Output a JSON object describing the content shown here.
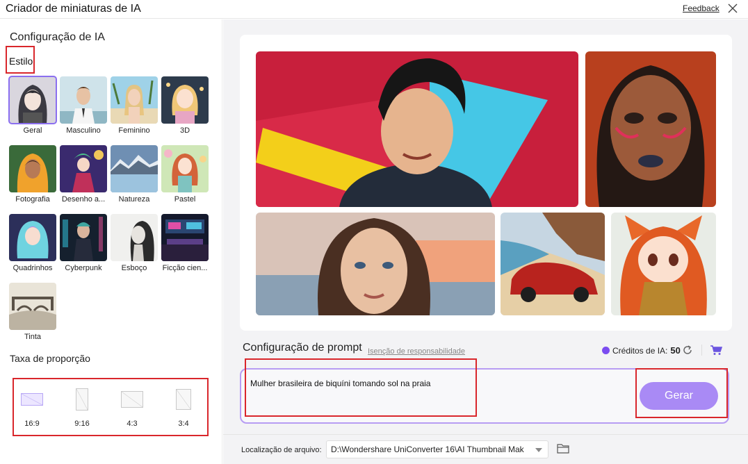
{
  "window": {
    "title": "Criador de miniaturas de IA",
    "feedback": "Feedback"
  },
  "left": {
    "section_title": "Configuração de IA",
    "style_label": "Estilo",
    "styles": [
      {
        "label": "Geral",
        "icon": "anime-girl-portrait",
        "selected": true
      },
      {
        "label": "Masculino",
        "icon": "man-portrait"
      },
      {
        "label": "Feminino",
        "icon": "woman-beach-portrait"
      },
      {
        "label": "3D",
        "icon": "3d-character-portrait"
      },
      {
        "label": "Fotografia",
        "icon": "photo-portrait"
      },
      {
        "label": "Desenho a...",
        "icon": "cartoon-character"
      },
      {
        "label": "Natureza",
        "icon": "mountain-lake"
      },
      {
        "label": "Pastel",
        "icon": "pastel-character"
      },
      {
        "label": "Quadrinhos",
        "icon": "comic-character"
      },
      {
        "label": "Cyberpunk",
        "icon": "cyberpunk-character"
      },
      {
        "label": "Esboço",
        "icon": "sketch-portrait"
      },
      {
        "label": "Ficção cien...",
        "icon": "scifi-room"
      },
      {
        "label": "Tinta",
        "icon": "ink-bridge"
      }
    ],
    "ratio_title": "Taxa de proporção",
    "ratios": [
      {
        "label": "16:9",
        "active": true
      },
      {
        "label": "9:16"
      },
      {
        "label": "4:3"
      },
      {
        "label": "3:4"
      }
    ]
  },
  "right": {
    "prompt_title": "Configuração de prompt",
    "disclaimer": "Isenção de responsabilidade",
    "credits_label": "Créditos de IA:",
    "credits_value": "50",
    "prompt_value": "Mulher brasileira de biquíni tomando sol na praia",
    "generate_label": "Gerar",
    "location_label": "Localização de arquivo:",
    "location_value": "D:\\Wondershare UniConverter 16\\AI Thumbnail Mak"
  },
  "colors": {
    "accent": "#a98af5",
    "highlight": "#d9262b",
    "prompt_border": "#b79cf3"
  }
}
